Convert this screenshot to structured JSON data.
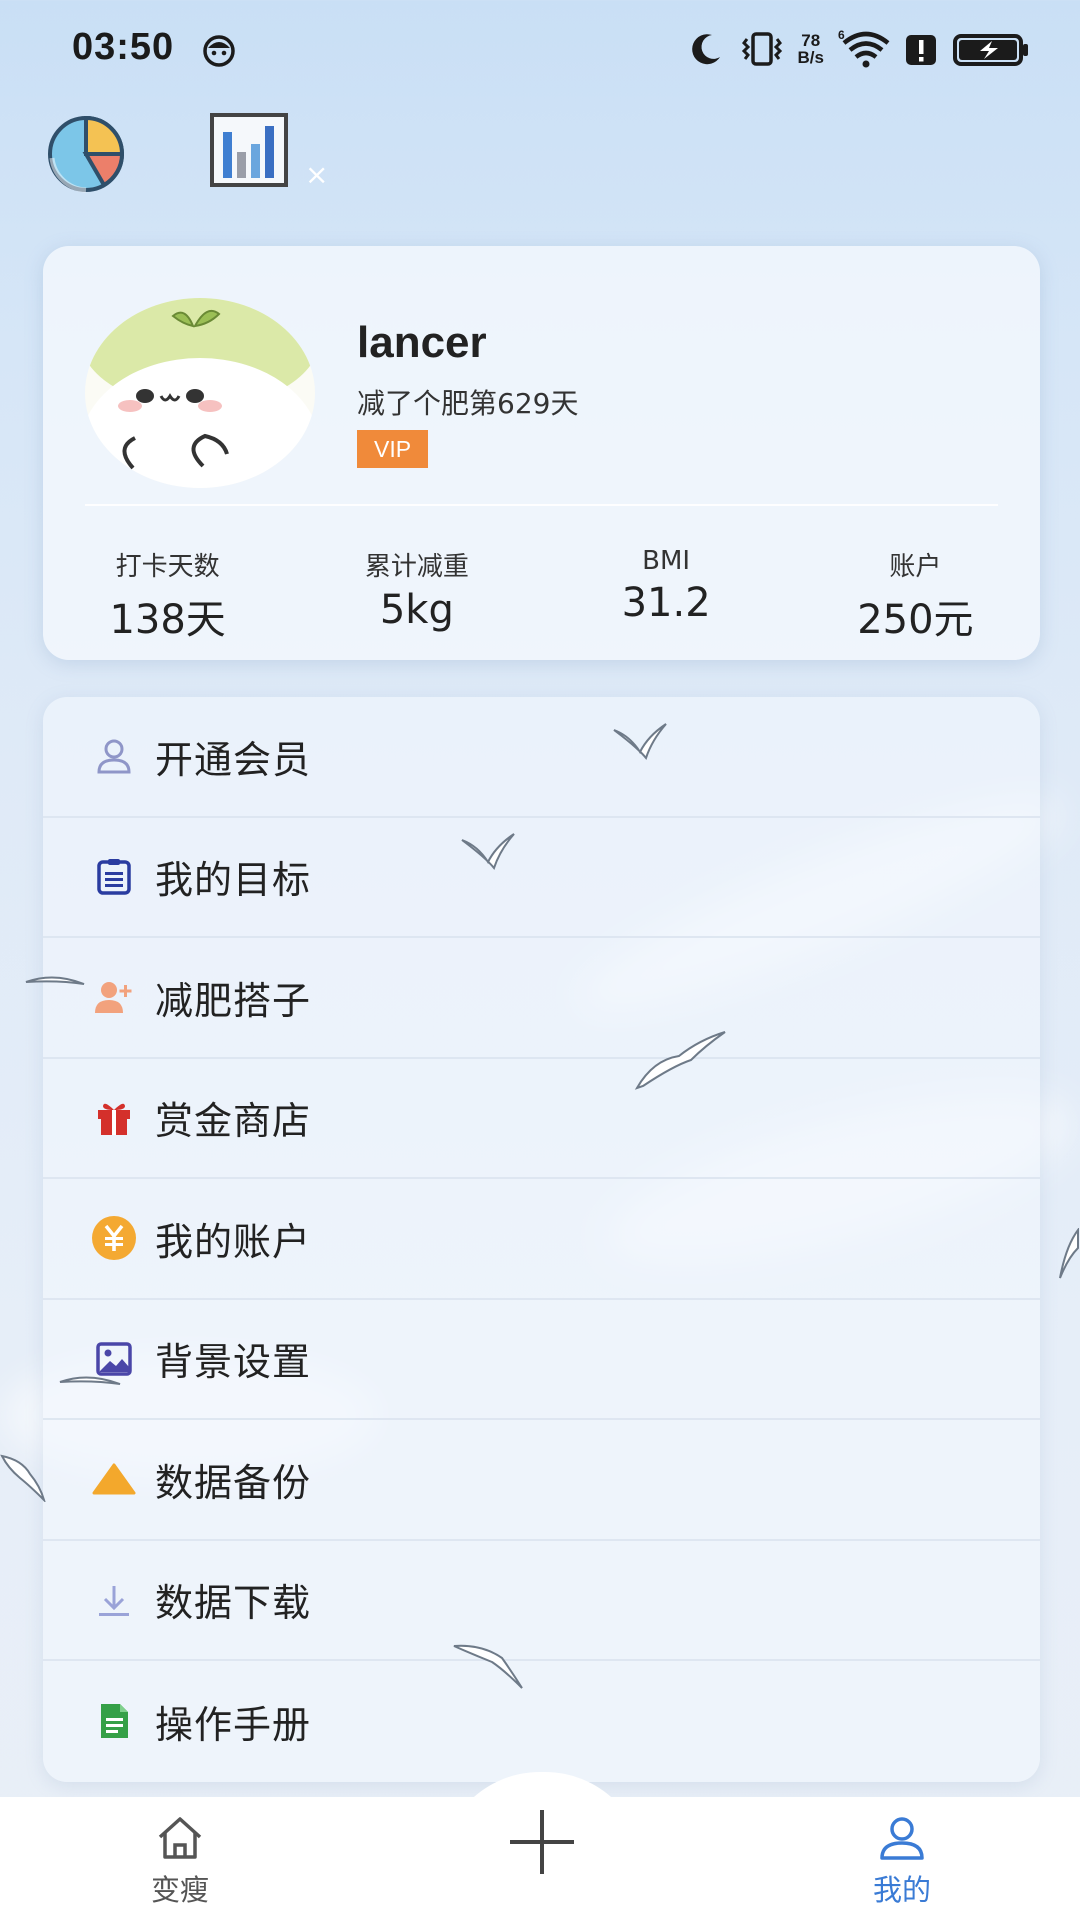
{
  "status_bar": {
    "time": "03:50",
    "net_speed_value": "78",
    "net_speed_unit": "B/s",
    "icons": [
      "face-icon",
      "moon-icon",
      "vibrate-icon",
      "wifi-icon",
      "alert-icon",
      "battery-charging-icon"
    ]
  },
  "toolbar": {
    "buttons": [
      "pie-chart-icon",
      "bar-chart-icon"
    ],
    "close": "×"
  },
  "profile": {
    "username": "lancer",
    "days_text": "减了个肥第629天",
    "badge": "VIP",
    "stats": [
      {
        "label": "打卡天数",
        "value": "138天"
      },
      {
        "label": "累计减重",
        "value": "5kg"
      },
      {
        "label": "BMI",
        "value": "31.2"
      },
      {
        "label": "账户",
        "value": "250元"
      }
    ]
  },
  "menu": {
    "items": [
      {
        "label": "开通会员",
        "icon": "user-icon"
      },
      {
        "label": "我的目标",
        "icon": "target-list-icon"
      },
      {
        "label": "减肥搭子",
        "icon": "add-friend-icon"
      },
      {
        "label": "赏金商店",
        "icon": "gift-icon"
      },
      {
        "label": "我的账户",
        "icon": "yuan-coin-icon"
      },
      {
        "label": "背景设置",
        "icon": "image-icon"
      },
      {
        "label": "数据备份",
        "icon": "triangle-icon"
      },
      {
        "label": "数据下载",
        "icon": "download-icon"
      },
      {
        "label": "操作手册",
        "icon": "document-icon"
      }
    ]
  },
  "bottom_nav": {
    "items": [
      {
        "label": "变瘦",
        "icon": "home-icon",
        "active": false
      },
      {
        "label": "我的",
        "icon": "profile-icon",
        "active": true
      }
    ],
    "fab_icon": "plus-icon"
  },
  "colors": {
    "accent": "#3a7bd5",
    "vip": "#f08a3a",
    "inactive_nav": "#555555"
  }
}
